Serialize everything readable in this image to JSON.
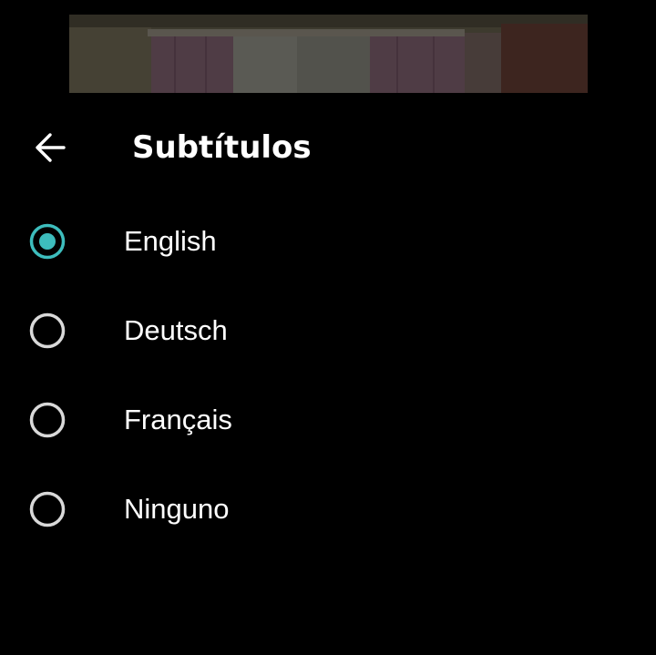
{
  "header": {
    "title": "Subtítulos",
    "back_icon": "arrow-left-icon"
  },
  "colors": {
    "background": "#000000",
    "accent": "#3dbdbd",
    "radio_unselected": "#d9d9d9",
    "text": "#ffffff"
  },
  "subtitles": {
    "selected": "English",
    "options": [
      {
        "label": "English",
        "selected": true
      },
      {
        "label": "Deutsch",
        "selected": false
      },
      {
        "label": "Français",
        "selected": false
      },
      {
        "label": "Ninguno",
        "selected": false
      }
    ]
  }
}
